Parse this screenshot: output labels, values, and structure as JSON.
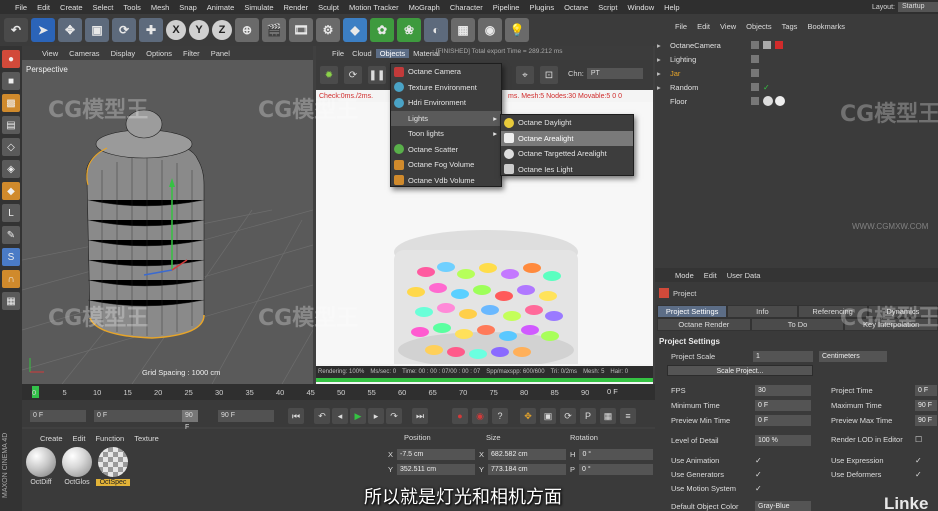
{
  "menubar": {
    "items": [
      "File",
      "Edit",
      "Create",
      "Select",
      "Tools",
      "Mesh",
      "Snap",
      "Animate",
      "Simulate",
      "Render",
      "Sculpt",
      "Motion Tracker",
      "MoGraph",
      "Character",
      "Pipeline",
      "Plugins",
      "Octane",
      "Script",
      "Window",
      "Help"
    ],
    "layout_label": "Layout:",
    "layout_value": "Startup"
  },
  "toolbar": {
    "axis_labels": [
      "X",
      "Y",
      "Z"
    ]
  },
  "viewport": {
    "menu": [
      "View",
      "Cameras",
      "Display",
      "Options",
      "Filter",
      "Panel"
    ],
    "name": "Perspective",
    "grid_spacing": "Grid Spacing : 1000 cm"
  },
  "render_view": {
    "menu": [
      "File",
      "Cloud",
      "Objects",
      "Material"
    ],
    "active_menu": "Objects",
    "status": "[FINISHED] Total export Time = 289.212 ms",
    "channel_label": "Chn:",
    "channel_value": "PT",
    "check_text": "Check:0ms./2ms.",
    "mesh_text": "ms. Mesh:5 Nodes:30 Movable:5  0  0",
    "bottom": [
      "Rendering: 100%",
      "Ms/sec: 0",
      "Time: 00 : 00 : 07/00 : 00 : 07",
      "Spp/maxspp: 600/600",
      "Tri: 0/2ms",
      "Mesh: 5",
      "Hair: 0"
    ],
    "progress": 1.0
  },
  "objects_menu": {
    "items": [
      "Octane Camera",
      "Texture Environment",
      "Hdri Environment",
      "Lights",
      "Toon lights",
      "Octane Scatter",
      "Octane Fog Volume",
      "Octane Vdb Volume"
    ],
    "highlighted": "Lights"
  },
  "lights_submenu": {
    "items": [
      "Octane Daylight",
      "Octane Arealight",
      "Octane Targetted Arealight",
      "Octane Ies Light"
    ],
    "highlighted": "Octane Arealight"
  },
  "object_manager": {
    "menu": [
      "File",
      "Edit",
      "View",
      "Objects",
      "Tags",
      "Bookmarks"
    ],
    "rows": [
      "OctaneCamera",
      "Lighting",
      "Jar",
      "Random",
      "Floor"
    ]
  },
  "attribute_manager": {
    "menu": [
      "Mode",
      "Edit",
      "User Data"
    ],
    "object": "Project",
    "tabs_row1": [
      "Project Settings",
      "Info",
      "Referencing",
      "Dynamics"
    ],
    "tabs_row2": [
      "Octane Render",
      "To Do",
      "Key Interpolation"
    ],
    "section": "Project Settings",
    "project_scale_label": "Project Scale",
    "project_scale_value": "1",
    "project_scale_unit": "Centimeters",
    "scale_project_button": "Scale Project...",
    "fps_label": "FPS",
    "fps_value": "30",
    "project_time_label": "Project Time",
    "project_time_value": "0 F",
    "min_time_label": "Minimum Time",
    "min_time_value": "0 F",
    "max_time_label": "Maximum Time",
    "max_time_value": "90 F",
    "preview_min_label": "Preview Min Time",
    "preview_min_value": "0 F",
    "preview_max_label": "Preview Max Time",
    "preview_max_value": "90 F",
    "lod_label": "Level of Detail",
    "lod_value": "100 %",
    "render_lod_label": "Render LOD in Editor",
    "use_animation": "Use Animation",
    "use_expression": "Use Expression",
    "use_generators": "Use Generators",
    "use_deformers": "Use Deformers",
    "use_motion_system": "Use Motion System",
    "default_color_label": "Default Object Color",
    "default_color_value": "Gray-Blue"
  },
  "timeline": {
    "ticks": [
      "0",
      "5",
      "10",
      "15",
      "20",
      "25",
      "30",
      "35",
      "40",
      "45",
      "50",
      "55",
      "60",
      "65",
      "70",
      "75",
      "80",
      "85",
      "90"
    ],
    "end_label": "0 F",
    "field": "0 F"
  },
  "transport": {
    "start": "0 F",
    "current": "0 F",
    "range_end": "90 F",
    "end": "90 F"
  },
  "material_manager": {
    "menu": [
      "Create",
      "Edit",
      "Function",
      "Texture"
    ],
    "materials": [
      "OctDiff",
      "OctGlos",
      "OctSpec"
    ],
    "selected": "OctSpec"
  },
  "coordinates": {
    "headers": [
      "Position",
      "Size",
      "Rotation"
    ],
    "x_pos": "-7.5 cm",
    "y_pos": "352.511 cm",
    "x_size": "682.582 cm",
    "y_size": "773.184 cm",
    "h_rot": "0 °",
    "p_rot": "0 °",
    "axis_x": "X",
    "axis_y": "Y",
    "axis_h": "H",
    "axis_p": "P"
  },
  "branding": {
    "vertical_logo": "MAXON CINEMA 4D",
    "watermark": "CG模型王",
    "watermark_url": "WWW.CGMXW.COM",
    "linkedin": "Linke"
  },
  "subtitle": "所以就是灯光和相机方面",
  "colors": {
    "accent": "#5c6d86",
    "progress": "#35c243",
    "selection": "#e2b338",
    "error_text": "#d02b2b"
  }
}
